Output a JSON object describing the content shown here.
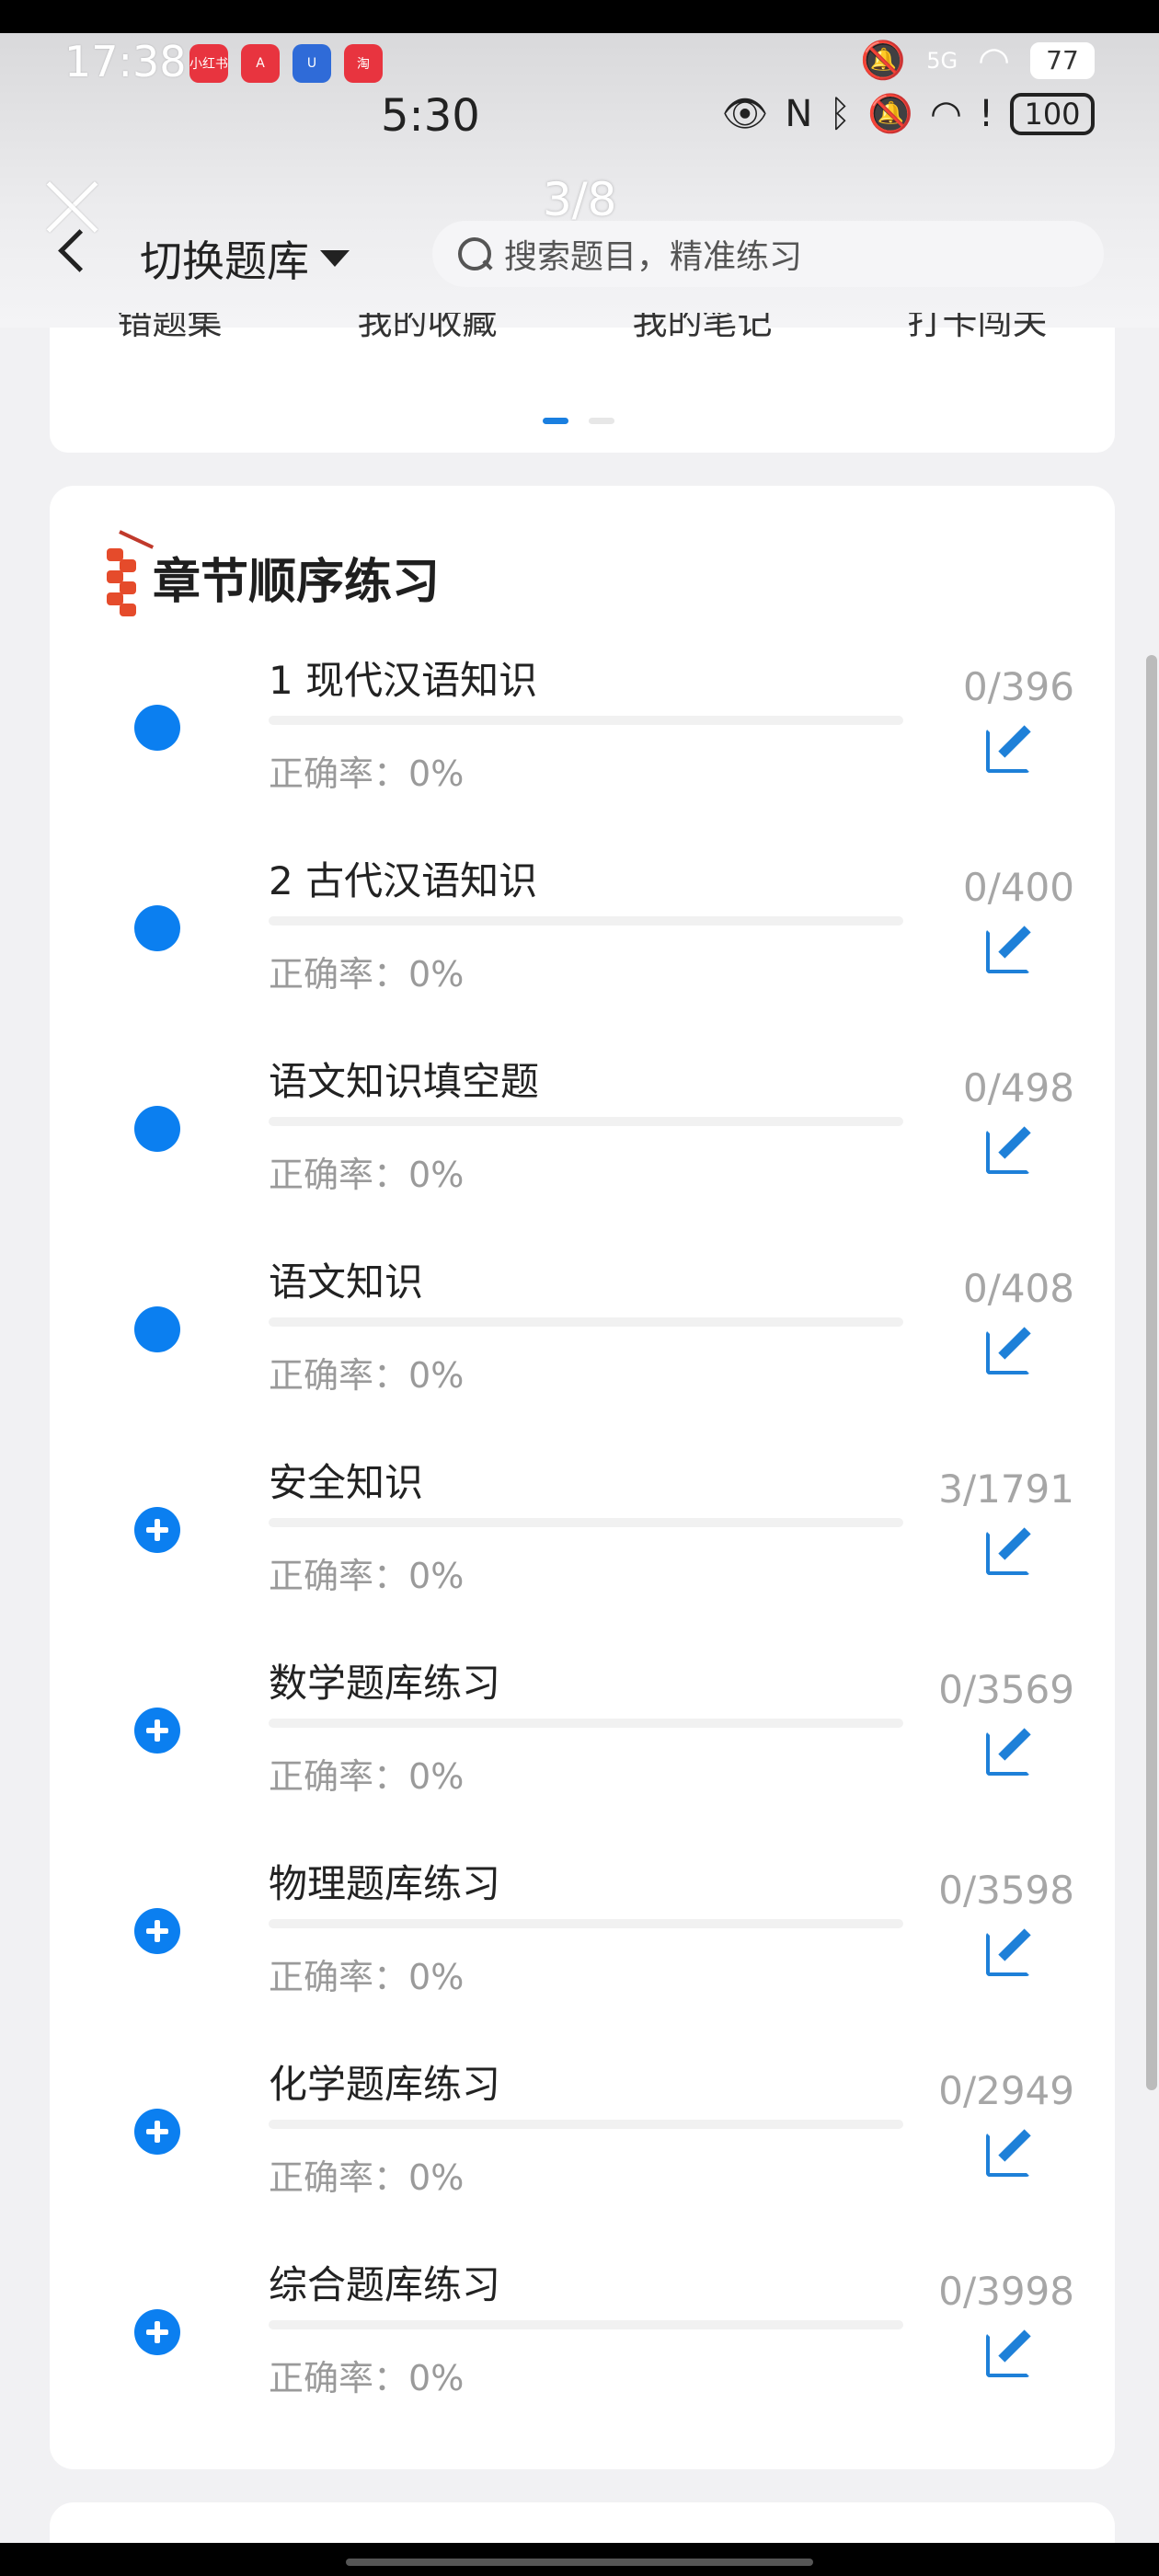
{
  "outer_status": {
    "time": "17:38",
    "apps": [
      {
        "name": "xiaohongshu-app-icon",
        "label": "小红书",
        "color": "#e8343f"
      },
      {
        "name": "a-app-icon",
        "label": "A",
        "color": "#e8343f"
      },
      {
        "name": "u-app-icon",
        "label": "U",
        "color": "#2f6bd8"
      },
      {
        "name": "red-app-icon",
        "label": "淘",
        "color": "#e8343f"
      }
    ],
    "signal": "5G",
    "battery": "77"
  },
  "inner_status": {
    "time": "5:30",
    "battery": "100"
  },
  "viewer": {
    "page_counter": "3/8"
  },
  "header": {
    "switch_label": "切换题库",
    "search_placeholder": "搜索题目，精准练习"
  },
  "menu": {
    "items": [
      "错题集",
      "我的收藏",
      "我的笔记",
      "打卡闯关"
    ]
  },
  "chapter": {
    "title": "章节顺序练习",
    "accuracy_label": "正确率：",
    "items": [
      {
        "title": "1 现代汉语知识",
        "accuracy": "0%",
        "count": "0/396",
        "icon": "dot"
      },
      {
        "title": "2 古代汉语知识",
        "accuracy": "0%",
        "count": "0/400",
        "icon": "dot"
      },
      {
        "title": "语文知识填空题",
        "accuracy": "0%",
        "count": "0/498",
        "icon": "dot"
      },
      {
        "title": "语文知识",
        "accuracy": "0%",
        "count": "0/408",
        "icon": "dot"
      },
      {
        "title": "安全知识",
        "accuracy": "0%",
        "count": "3/1791",
        "icon": "plus"
      },
      {
        "title": "数学题库练习",
        "accuracy": "0%",
        "count": "0/3569",
        "icon": "plus"
      },
      {
        "title": "物理题库练习",
        "accuracy": "0%",
        "count": "0/3598",
        "icon": "plus"
      },
      {
        "title": "化学题库练习",
        "accuracy": "0%",
        "count": "0/2949",
        "icon": "plus"
      },
      {
        "title": "综合题库练习",
        "accuracy": "0%",
        "count": "0/3998",
        "icon": "plus"
      }
    ]
  },
  "colors": {
    "accent": "#0b7ff0",
    "edit_icon": "#1e80d8",
    "muted_text": "#9a9a9a"
  }
}
